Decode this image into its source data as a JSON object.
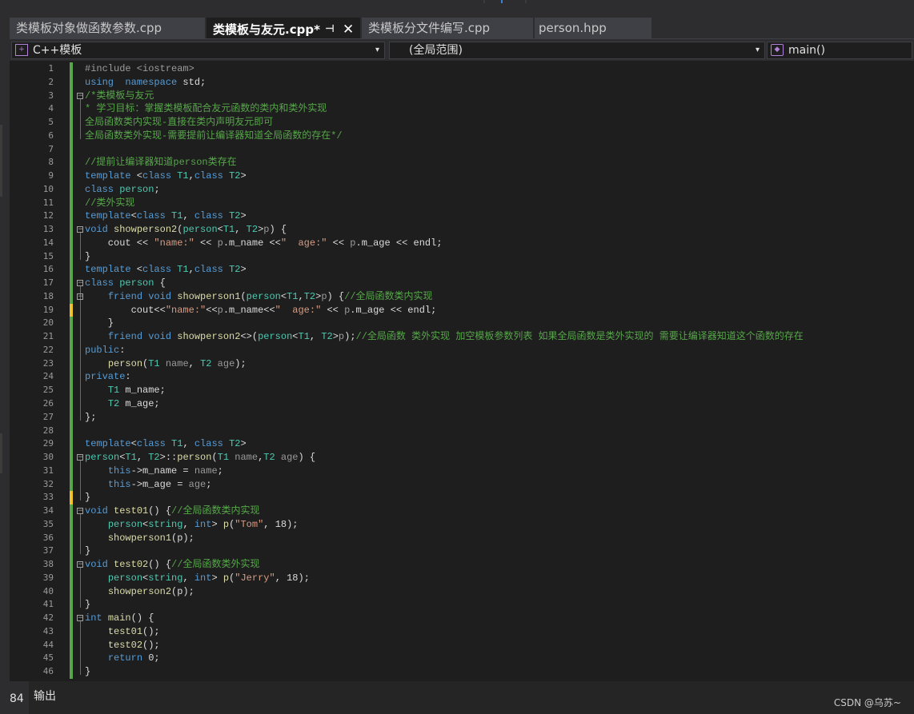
{
  "tabs": [
    {
      "label": "类模板对象做函数参数.cpp",
      "active": false
    },
    {
      "label": "类模板与友元.cpp*",
      "active": true,
      "pin": "⊣",
      "close": "✕"
    },
    {
      "label": "类模板分文件编写.cpp",
      "active": false
    },
    {
      "label": "person.hpp",
      "active": false
    }
  ],
  "nav": {
    "project_icon": "project-icon",
    "project": "C++模板",
    "scope": "(全局范围)",
    "member_icon": "method-cube-icon",
    "member": "main()",
    "caret": "▾"
  },
  "status": {
    "zoom": "84",
    "output_title": "输出",
    "watermark": "CSDN @乌苏~"
  },
  "colors": {
    "keyword": "#569cd6",
    "type": "#4ec9b0",
    "comment": "#57a64a",
    "string": "#d69d85",
    "preprocessor": "#9b9b9b",
    "function": "#dcdcaa",
    "change_saved": "#57a64a",
    "change_unsaved": "#f0c32d"
  },
  "code": [
    {
      "n": "1",
      "t": [
        [
          "pp",
          "#include <iostream>"
        ]
      ]
    },
    {
      "n": "2",
      "t": [
        [
          "kw",
          "using"
        ],
        [
          "",
          "  "
        ],
        [
          "kw",
          "namespace"
        ],
        [
          "",
          " std;"
        ]
      ]
    },
    {
      "n": "3",
      "t": [
        [
          "cm",
          "/*类模板与友元"
        ]
      ]
    },
    {
      "n": "4",
      "t": [
        [
          "cm",
          "* 学习目标：掌握类模板配合友元函数的类内和类外实现"
        ]
      ]
    },
    {
      "n": "5",
      "t": [
        [
          "cm",
          "全局函数类内实现-直接在类内声明友元即可"
        ]
      ]
    },
    {
      "n": "6",
      "t": [
        [
          "cm",
          "全局函数类外实现-需要提前让编译器知道全局函数的存在*/"
        ]
      ]
    },
    {
      "n": "7",
      "t": []
    },
    {
      "n": "8",
      "t": [
        [
          "cm",
          "//提前让编译器知道person类存在"
        ]
      ]
    },
    {
      "n": "9",
      "t": [
        [
          "kw",
          "template"
        ],
        [
          "",
          " <"
        ],
        [
          "kw",
          "class"
        ],
        [
          "",
          " "
        ],
        [
          "ty",
          "T1"
        ],
        [
          ",",
          ""
        ],
        [
          "",
          ","
        ],
        [
          "kw",
          "class"
        ],
        [
          "",
          " "
        ],
        [
          "ty",
          "T2"
        ],
        [
          "",
          ">"
        ]
      ]
    },
    {
      "n": "10",
      "t": [
        [
          "kw",
          "class"
        ],
        [
          "",
          " "
        ],
        [
          "ty",
          "person"
        ],
        [
          "",
          ";"
        ]
      ]
    },
    {
      "n": "11",
      "t": [
        [
          "cm",
          "//类外实现"
        ]
      ]
    },
    {
      "n": "12",
      "t": [
        [
          "kw",
          "template"
        ],
        [
          "",
          "<"
        ],
        [
          "kw",
          "class"
        ],
        [
          "",
          " "
        ],
        [
          "ty",
          "T1"
        ],
        [
          "",
          ", "
        ],
        [
          "kw",
          "class"
        ],
        [
          "",
          " "
        ],
        [
          "ty",
          "T2"
        ],
        [
          "",
          ">"
        ]
      ]
    },
    {
      "n": "13",
      "t": [
        [
          "kw",
          "void"
        ],
        [
          "",
          " "
        ],
        [
          "fn",
          "showperson2"
        ],
        [
          "",
          "("
        ],
        [
          "ty",
          "person"
        ],
        [
          "",
          "<"
        ],
        [
          "ty",
          "T1"
        ],
        [
          "",
          ", "
        ],
        [
          "ty",
          "T2"
        ],
        [
          "",
          ">"
        ],
        [
          "pa",
          "p"
        ],
        [
          "",
          ") {"
        ]
      ]
    },
    {
      "n": "14",
      "t": [
        [
          "",
          "    cout << "
        ],
        [
          "st",
          "\"name:\""
        ],
        [
          "",
          " << "
        ],
        [
          "pa",
          "p"
        ],
        [
          "",
          ".m_name <<"
        ],
        [
          "st",
          "\"  age:\""
        ],
        [
          "",
          " << "
        ],
        [
          "pa",
          "p"
        ],
        [
          "",
          ".m_age << endl;"
        ]
      ]
    },
    {
      "n": "15",
      "t": [
        [
          "",
          "}"
        ]
      ]
    },
    {
      "n": "16",
      "t": [
        [
          "kw",
          "template"
        ],
        [
          "",
          " <"
        ],
        [
          "kw",
          "class"
        ],
        [
          "",
          " "
        ],
        [
          "ty",
          "T1"
        ],
        [
          "",
          ","
        ],
        [
          "kw",
          "class"
        ],
        [
          "",
          " "
        ],
        [
          "ty",
          "T2"
        ],
        [
          "",
          ">"
        ]
      ]
    },
    {
      "n": "17",
      "t": [
        [
          "kw",
          "class"
        ],
        [
          "",
          " "
        ],
        [
          "ty",
          "person"
        ],
        [
          "",
          " {"
        ]
      ]
    },
    {
      "n": "18",
      "t": [
        [
          "",
          "    "
        ],
        [
          "kw",
          "friend"
        ],
        [
          "",
          " "
        ],
        [
          "kw",
          "void"
        ],
        [
          "",
          " "
        ],
        [
          "fn",
          "showperson1"
        ],
        [
          "",
          "("
        ],
        [
          "ty",
          "person"
        ],
        [
          "",
          "<"
        ],
        [
          "ty",
          "T1"
        ],
        [
          "",
          ","
        ],
        [
          "ty",
          "T2"
        ],
        [
          "",
          ">"
        ],
        [
          "pa",
          "p"
        ],
        [
          "",
          ") {"
        ],
        [
          "cm",
          "//全局函数类内实现"
        ]
      ]
    },
    {
      "n": "19",
      "t": [
        [
          "",
          "        cout<<"
        ],
        [
          "st",
          "\"name:\""
        ],
        [
          "",
          "<<"
        ],
        [
          "pa",
          "p"
        ],
        [
          "",
          ".m_name<<"
        ],
        [
          "st",
          "\"  age:\""
        ],
        [
          "",
          " << "
        ],
        [
          "pa",
          "p"
        ],
        [
          "",
          ".m_age << endl;"
        ]
      ]
    },
    {
      "n": "20",
      "t": [
        [
          "",
          "    }"
        ]
      ]
    },
    {
      "n": "21",
      "t": [
        [
          "",
          "    "
        ],
        [
          "kw",
          "friend"
        ],
        [
          "",
          " "
        ],
        [
          "kw",
          "void"
        ],
        [
          "",
          " "
        ],
        [
          "fn",
          "showperson2"
        ],
        [
          "",
          "<>("
        ],
        [
          "ty",
          "person"
        ],
        [
          "",
          "<"
        ],
        [
          "ty",
          "T1"
        ],
        [
          "",
          ", "
        ],
        [
          "ty",
          "T2"
        ],
        [
          "",
          ">"
        ],
        [
          "pa",
          "p"
        ],
        [
          "",
          ");"
        ],
        [
          "cm",
          "//全局函数 类外实现 加空模板参数列表 如果全局函数是类外实现的 需要让编译器知道这个函数的存在"
        ]
      ]
    },
    {
      "n": "22",
      "t": [
        [
          "kw",
          "public"
        ],
        [
          "",
          ":"
        ]
      ]
    },
    {
      "n": "23",
      "t": [
        [
          "",
          "    "
        ],
        [
          "fn",
          "person"
        ],
        [
          "",
          "("
        ],
        [
          "ty",
          "T1"
        ],
        [
          "",
          " "
        ],
        [
          "pa",
          "name"
        ],
        [
          "",
          ", "
        ],
        [
          "ty",
          "T2"
        ],
        [
          "",
          " "
        ],
        [
          "pa",
          "age"
        ],
        [
          "",
          ");"
        ]
      ]
    },
    {
      "n": "24",
      "t": [
        [
          "kw",
          "private"
        ],
        [
          "",
          ":"
        ]
      ]
    },
    {
      "n": "25",
      "t": [
        [
          "",
          "    "
        ],
        [
          "ty",
          "T1"
        ],
        [
          "",
          " m_name;"
        ]
      ]
    },
    {
      "n": "26",
      "t": [
        [
          "",
          "    "
        ],
        [
          "ty",
          "T2"
        ],
        [
          "",
          " m_age;"
        ]
      ]
    },
    {
      "n": "27",
      "t": [
        [
          "",
          "};"
        ]
      ]
    },
    {
      "n": "28",
      "t": []
    },
    {
      "n": "29",
      "t": [
        [
          "kw",
          "template"
        ],
        [
          "",
          "<"
        ],
        [
          "kw",
          "class"
        ],
        [
          "",
          " "
        ],
        [
          "ty",
          "T1"
        ],
        [
          "",
          ", "
        ],
        [
          "kw",
          "class"
        ],
        [
          "",
          " "
        ],
        [
          "ty",
          "T2"
        ],
        [
          "",
          ">"
        ]
      ]
    },
    {
      "n": "30",
      "t": [
        [
          "ty",
          "person"
        ],
        [
          "",
          "<"
        ],
        [
          "ty",
          "T1"
        ],
        [
          "",
          ", "
        ],
        [
          "ty",
          "T2"
        ],
        [
          "",
          ">::"
        ],
        [
          "fn",
          "person"
        ],
        [
          "",
          "("
        ],
        [
          "ty",
          "T1"
        ],
        [
          "",
          " "
        ],
        [
          "pa",
          "name"
        ],
        [
          "",
          ","
        ],
        [
          "ty",
          "T2"
        ],
        [
          "",
          " "
        ],
        [
          "pa",
          "age"
        ],
        [
          "",
          ") {"
        ]
      ]
    },
    {
      "n": "31",
      "t": [
        [
          "",
          "    "
        ],
        [
          "kw",
          "this"
        ],
        [
          "",
          "->m_name = "
        ],
        [
          "pa",
          "name"
        ],
        [
          "",
          ";"
        ]
      ]
    },
    {
      "n": "32",
      "t": [
        [
          "",
          "    "
        ],
        [
          "kw",
          "this"
        ],
        [
          "",
          "->m_age = "
        ],
        [
          "pa",
          "age"
        ],
        [
          "",
          ";"
        ]
      ]
    },
    {
      "n": "33",
      "t": [
        [
          "",
          "}"
        ]
      ]
    },
    {
      "n": "34",
      "t": [
        [
          "kw",
          "void"
        ],
        [
          "",
          " "
        ],
        [
          "fn",
          "test01"
        ],
        [
          "",
          "() {"
        ],
        [
          "cm",
          "//全局函数类内实现"
        ]
      ]
    },
    {
      "n": "35",
      "t": [
        [
          "",
          "    "
        ],
        [
          "ty",
          "person"
        ],
        [
          "",
          "<"
        ],
        [
          "ty",
          "string"
        ],
        [
          "",
          ", "
        ],
        [
          "kw",
          "int"
        ],
        [
          "",
          "> "
        ],
        [
          "fn",
          "p"
        ],
        [
          "",
          "("
        ],
        [
          "st",
          "\"Tom\""
        ],
        [
          "",
          ", 18);"
        ]
      ]
    },
    {
      "n": "36",
      "t": [
        [
          "",
          "    "
        ],
        [
          "fn",
          "showperson1"
        ],
        [
          "",
          "(p);"
        ]
      ]
    },
    {
      "n": "37",
      "t": [
        [
          "",
          "}"
        ]
      ]
    },
    {
      "n": "38",
      "t": [
        [
          "kw",
          "void"
        ],
        [
          "",
          " "
        ],
        [
          "fn",
          "test02"
        ],
        [
          "",
          "() {"
        ],
        [
          "cm",
          "//全局函数类外实现"
        ]
      ]
    },
    {
      "n": "39",
      "t": [
        [
          "",
          "    "
        ],
        [
          "ty",
          "person"
        ],
        [
          "",
          "<"
        ],
        [
          "ty",
          "string"
        ],
        [
          "",
          ", "
        ],
        [
          "kw",
          "int"
        ],
        [
          "",
          "> "
        ],
        [
          "fn",
          "p"
        ],
        [
          "",
          "("
        ],
        [
          "st",
          "\"Jerry\""
        ],
        [
          "",
          ", 18);"
        ]
      ]
    },
    {
      "n": "40",
      "t": [
        [
          "",
          "    "
        ],
        [
          "fn",
          "showperson2"
        ],
        [
          "",
          "(p);"
        ]
      ]
    },
    {
      "n": "41",
      "t": [
        [
          "",
          "}"
        ]
      ]
    },
    {
      "n": "42",
      "t": [
        [
          "kw",
          "int"
        ],
        [
          "",
          " "
        ],
        [
          "fn",
          "main"
        ],
        [
          "",
          "() {"
        ]
      ]
    },
    {
      "n": "43",
      "t": [
        [
          "",
          "    "
        ],
        [
          "fn",
          "test01"
        ],
        [
          "",
          "();"
        ]
      ]
    },
    {
      "n": "44",
      "t": [
        [
          "",
          "    "
        ],
        [
          "fn",
          "test02"
        ],
        [
          "",
          "();"
        ]
      ]
    },
    {
      "n": "45",
      "t": [
        [
          "",
          "    "
        ],
        [
          "kw",
          "return"
        ],
        [
          "",
          " 0;"
        ]
      ]
    },
    {
      "n": "46",
      "t": [
        [
          "",
          "}"
        ]
      ]
    }
  ]
}
